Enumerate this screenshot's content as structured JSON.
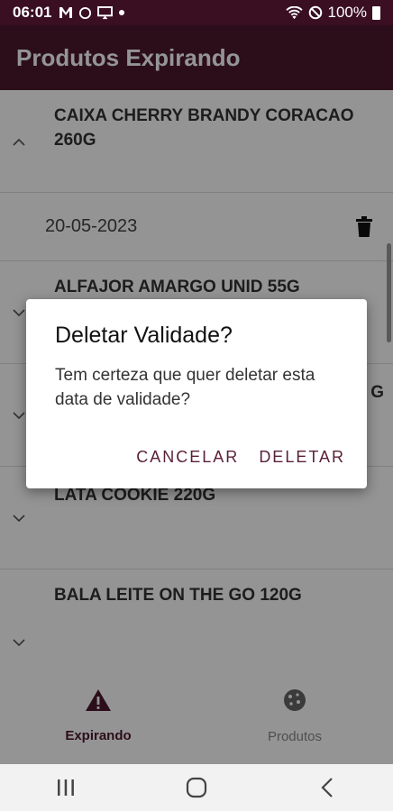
{
  "status_bar": {
    "time": "06:01",
    "left_icons": [
      "mail-icon",
      "circle-icon",
      "screen-cast-icon",
      "dot-icon"
    ],
    "battery": "100%",
    "right_icons": [
      "wifi-icon",
      "do-not-disturb-icon",
      "battery-icon"
    ]
  },
  "app_bar": {
    "title": "Produtos Expirando"
  },
  "list": {
    "items": [
      {
        "name": "CAIXA CHERRY BRANDY CORACAO 260G",
        "expanded": true,
        "date": "20-05-2023"
      },
      {
        "name": "ALFAJOR AMARGO UNID 55G",
        "expanded": false
      },
      {
        "name": "G",
        "expanded": false
      },
      {
        "name": "LATA COOKIE 220G",
        "expanded": false
      },
      {
        "name": "BALA LEITE ON THE GO 120G",
        "expanded": false
      }
    ]
  },
  "bottom_nav": {
    "tabs": [
      {
        "label": "Expirando",
        "icon": "warning-icon",
        "active": true
      },
      {
        "label": "Produtos",
        "icon": "cookie-icon",
        "active": false
      }
    ]
  },
  "dialog": {
    "title": "Deletar Validade?",
    "message": "Tem certeza que quer deletar esta data de validade?",
    "cancel_label": "CANCELAR",
    "confirm_label": "DELETAR"
  },
  "colors": {
    "status_bar": "#3a0f22",
    "app_bar": "#4d1930",
    "accent": "#5a1f38"
  }
}
